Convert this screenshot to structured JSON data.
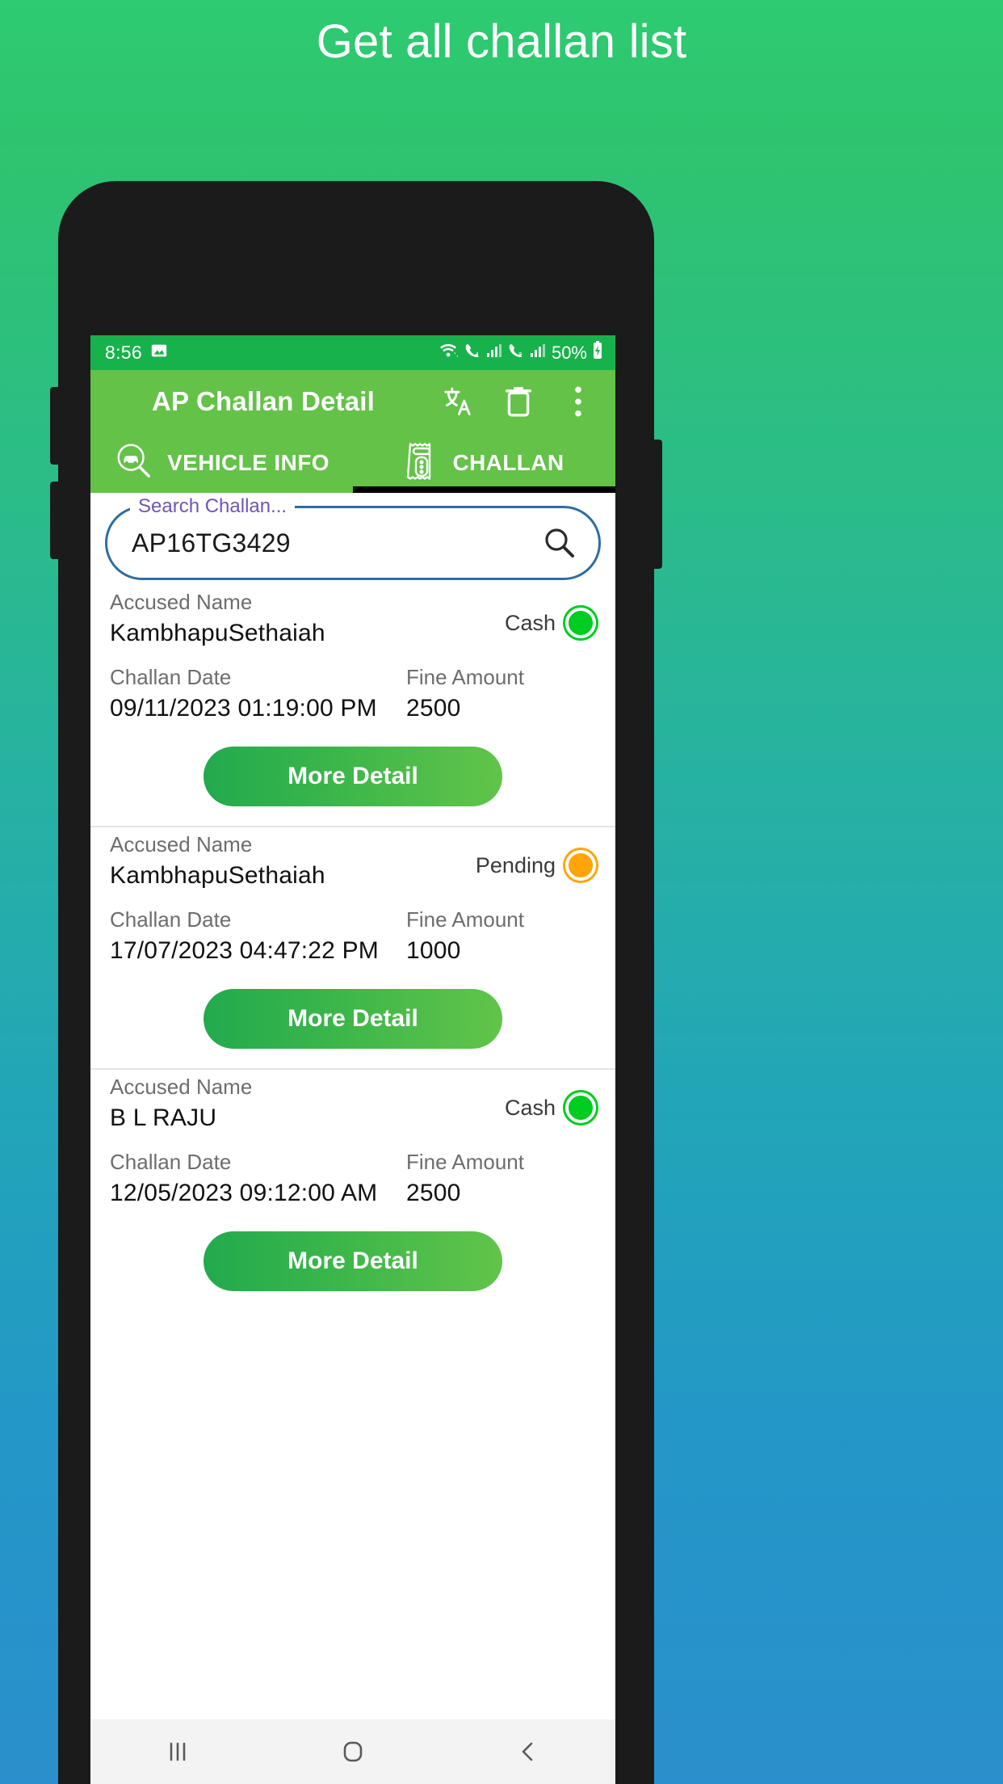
{
  "promo": {
    "headline": "Get all challan list"
  },
  "statusbar": {
    "clock": "8:56",
    "battery": "50%",
    "icons": [
      "image-icon",
      "wifi-icon",
      "call-sim1-icon",
      "signal-sim1-icon",
      "call-sim2-icon",
      "signal-sim2-icon",
      "battery-charging-icon"
    ]
  },
  "appbar": {
    "title": "AP Challan Detail",
    "actions": [
      {
        "name": "translate-icon"
      },
      {
        "name": "delete-icon"
      },
      {
        "name": "overflow-menu-icon"
      }
    ]
  },
  "tabs": [
    {
      "label": "VEHICLE INFO",
      "icon": "car-search-icon",
      "selected": false
    },
    {
      "label": "CHALLAN",
      "icon": "challan-receipt-icon",
      "selected": true
    }
  ],
  "search": {
    "label": "Search Challan...",
    "value": "AP16TG3429",
    "icon": "search-icon"
  },
  "labels": {
    "accused_name": "Accused Name",
    "challan_date": "Challan Date",
    "fine_amount": "Fine Amount",
    "more_detail": "More Detail"
  },
  "challans": [
    {
      "accused_name": "KambhapuSethaiah",
      "challan_date": "09/11/2023 01:19:00 PM",
      "fine_amount": "2500",
      "status": "Cash",
      "status_color": "#00cc22"
    },
    {
      "accused_name": "KambhapuSethaiah",
      "challan_date": "17/07/2023 04:47:22 PM",
      "fine_amount": "1000",
      "status": "Pending",
      "status_color": "#ffa50a"
    },
    {
      "accused_name": "B L RAJU",
      "challan_date": "12/05/2023 09:12:00 AM",
      "fine_amount": "2500",
      "status": "Cash",
      "status_color": "#00cc22"
    }
  ],
  "navbar": [
    {
      "name": "recents-button"
    },
    {
      "name": "home-button"
    },
    {
      "name": "back-button"
    }
  ],
  "colors": {
    "brand_green": "#63c247",
    "status_green": "#18b24c",
    "bg_top": "#2ecb71",
    "bg_bottom": "#2a8fcc",
    "field_border": "#2e6da4",
    "field_label": "#6b57b8"
  }
}
